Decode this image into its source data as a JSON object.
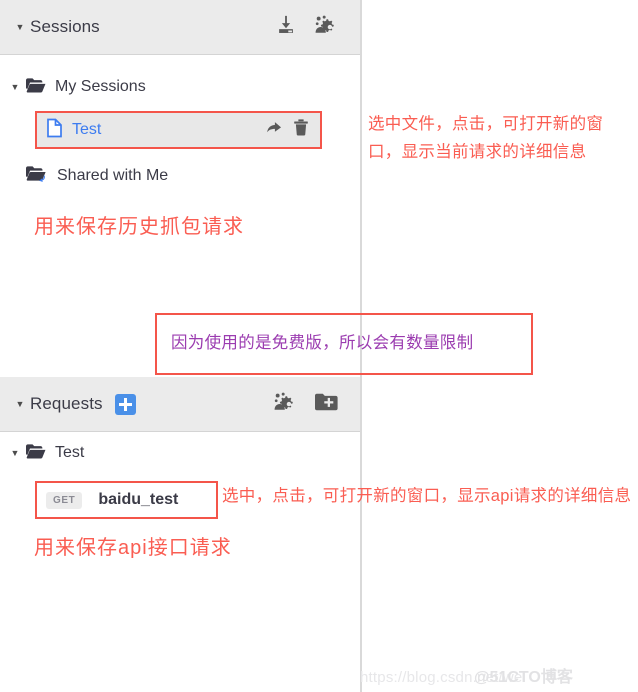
{
  "sessions_panel": {
    "header": {
      "caret": "▼",
      "title": "Sessions",
      "icons": [
        {
          "name": "import-sessions-icon",
          "label": "download"
        },
        {
          "name": "manage-sessions-icon",
          "label": "people-settings"
        }
      ]
    },
    "my_sessions": {
      "caret": "▼",
      "label": "My Sessions",
      "icon": "folder-open-icon"
    },
    "selected_session": {
      "label": "Test",
      "icon": "file-icon",
      "actions": [
        {
          "name": "share-icon",
          "label": "share"
        },
        {
          "name": "delete-icon",
          "label": "trash"
        }
      ],
      "selected": true
    },
    "shared_with_me": {
      "label": "Shared with Me",
      "icon": "folder-shared-icon"
    }
  },
  "requests_panel": {
    "header": {
      "caret": "▼",
      "title": "Requests",
      "add_badge": "+",
      "icons": [
        {
          "name": "manage-requests-icon",
          "label": "people-settings"
        },
        {
          "name": "new-folder-icon",
          "label": "folder-plus"
        }
      ]
    },
    "folder": {
      "caret": "▼",
      "label": "Test",
      "icon": "folder-open-icon"
    },
    "request_item": {
      "method": "GET",
      "name": "baidu_test"
    }
  },
  "annotations": {
    "session_detail": "选中文件，点击，可打开新的窗口，显示当前请求的详细信息",
    "sessions_description": "用来保存历史抓包请求",
    "free_version_note": "因为使用的是免费版，所以会有数量限制",
    "api_detail": "选中，点击，可打开新的窗口，显示api请求的详细信息",
    "requests_description": "用来保存api接口请求"
  },
  "watermark": {
    "url": "https://blog.csdn.net/wei",
    "brand": "@51CTO博客"
  },
  "colors": {
    "annotation_red": "#fa5d52",
    "box_border_red": "#f4554a",
    "note_purple": "#9b3cb0",
    "selected_text_blue": "#3d7cf0",
    "add_badge_blue": "#4a90e8",
    "header_bg": "#ebebeb",
    "selected_row_bg": "#e8e8e8"
  }
}
